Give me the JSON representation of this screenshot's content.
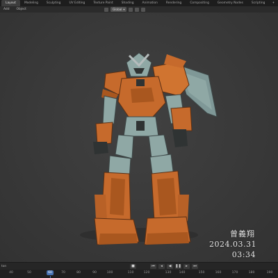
{
  "top_tabs": {
    "items": [
      "Layout",
      "Modeling",
      "Sculpting",
      "UV Editing",
      "Texture Paint",
      "Shading",
      "Animation",
      "Rendering",
      "Compositing",
      "Geometry Nodes",
      "Scripting"
    ],
    "active_index": 0,
    "add_label": "+"
  },
  "header": {
    "add_label": "Add",
    "object_label": "Object",
    "transform_dropdown": "Global"
  },
  "overlay": {
    "name": "曾義翔",
    "date": "2024.03.31",
    "time": "03:34"
  },
  "playback": {
    "left_label": "ton",
    "controls": [
      "stop-icon",
      "jump-start-icon",
      "step-back-icon",
      "play-reverse-icon",
      "pause-icon",
      "step-forward-icon",
      "jump-end-icon"
    ]
  },
  "timeline": {
    "ticks": [
      "40",
      "50",
      "70",
      "80",
      "90",
      "100",
      "110",
      "120",
      "130",
      "140",
      "150",
      "160",
      "170",
      "180",
      "190"
    ],
    "current_frame": "60"
  },
  "colors": {
    "armor_orange": "#c66a2c",
    "armor_teal": "#8fa8a5",
    "frame_dark": "#2f3333",
    "accent_blue": "#4772b3"
  }
}
